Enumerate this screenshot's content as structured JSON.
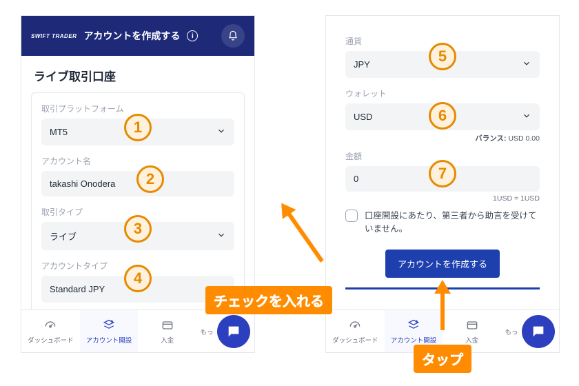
{
  "left": {
    "brand": "SWIFT TRADER",
    "header_title": "アカウントを作成する",
    "section_title": "ライブ取引口座",
    "fields": {
      "platform_label": "取引プラットフォーム",
      "platform_value": "MT5",
      "account_name_label": "アカウント名",
      "account_name_value": "takashi Onodera",
      "trade_type_label": "取引タイプ",
      "trade_type_value": "ライブ",
      "account_type_label": "アカウントタイプ",
      "account_type_value": "Standard JPY"
    }
  },
  "right": {
    "fields": {
      "currency_label": "通貨",
      "currency_value": "JPY",
      "wallet_label": "ウォレット",
      "wallet_value": "USD",
      "balance_label": "バランス:",
      "balance_value": "USD 0.00",
      "amount_label": "金額",
      "amount_value": "0",
      "rate": "1USD = 1USD"
    },
    "checkbox_text": "口座開設にあたり、第三者から助言を受けていません。",
    "create_button": "アカウントを作成する"
  },
  "tabs": {
    "dashboard": "ダッシュボード",
    "account_open": "アカウント開設",
    "deposit": "入金",
    "more": "もっ"
  },
  "annotations": {
    "n1": "1",
    "n2": "2",
    "n3": "3",
    "n4": "4",
    "n5": "5",
    "n6": "6",
    "n7": "7",
    "check_hint": "チェックを入れる",
    "tap_hint": "タップ"
  }
}
